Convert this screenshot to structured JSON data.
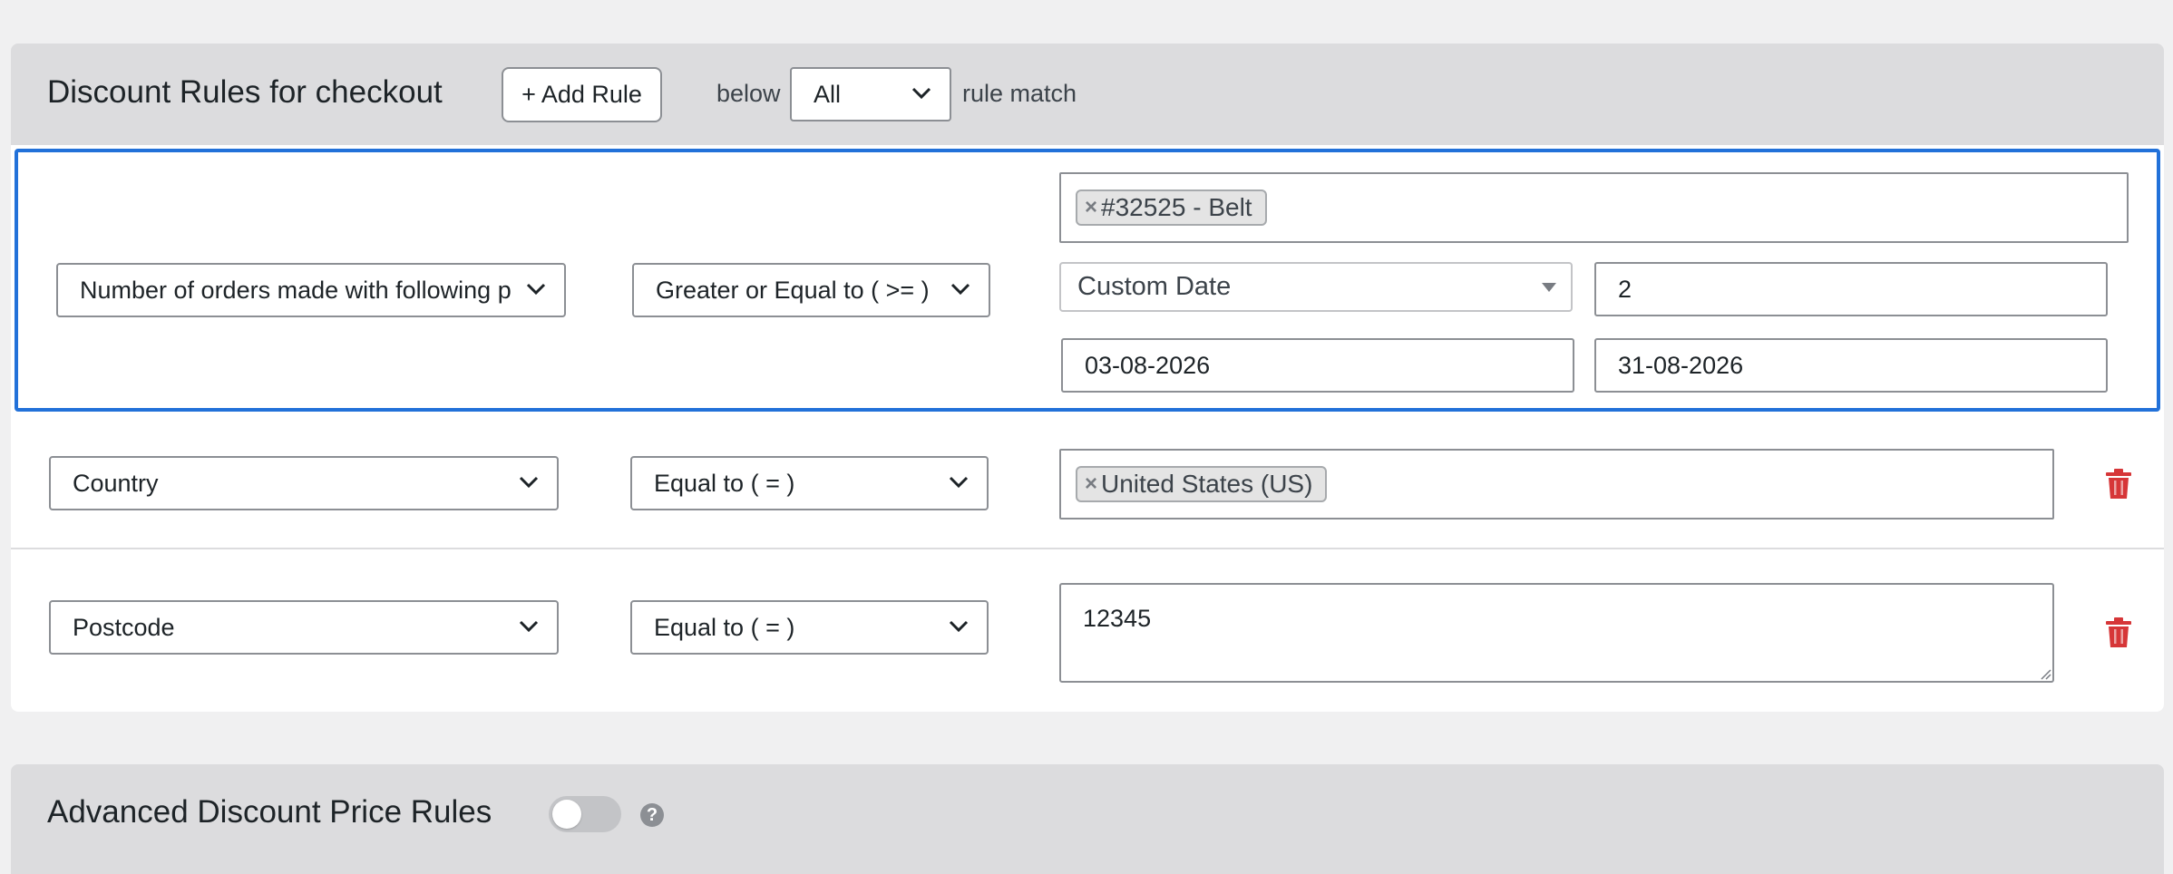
{
  "checkout_panel": {
    "title": "Discount Rules for checkout",
    "add_rule_label": "+ Add Rule",
    "below_label": "below",
    "match_value": "All",
    "rule_match_label": "rule match"
  },
  "rules": [
    {
      "condition": "Number of orders made with following p",
      "operator": "Greater or Equal to ( >= )",
      "product_tag": "#32525 - Belt",
      "date_type": "Custom Date",
      "count": "2",
      "date_from": "03-08-2026",
      "date_to": "31-08-2026"
    },
    {
      "condition": "Country",
      "operator": "Equal to ( = )",
      "country_tag": "United States (US)"
    },
    {
      "condition": "Postcode",
      "operator": "Equal to ( = )",
      "postcode": "12345"
    }
  ],
  "advanced_panel": {
    "title": "Advanced Discount Price Rules",
    "help": "?"
  },
  "colors": {
    "accent": "#2271d9",
    "delete": "#d63638",
    "panel": "#dcdcde"
  },
  "icons": {
    "dropdown": "chevron-down-icon",
    "delete": "trash-icon",
    "remove_tag": "close-icon",
    "help": "help-icon"
  }
}
